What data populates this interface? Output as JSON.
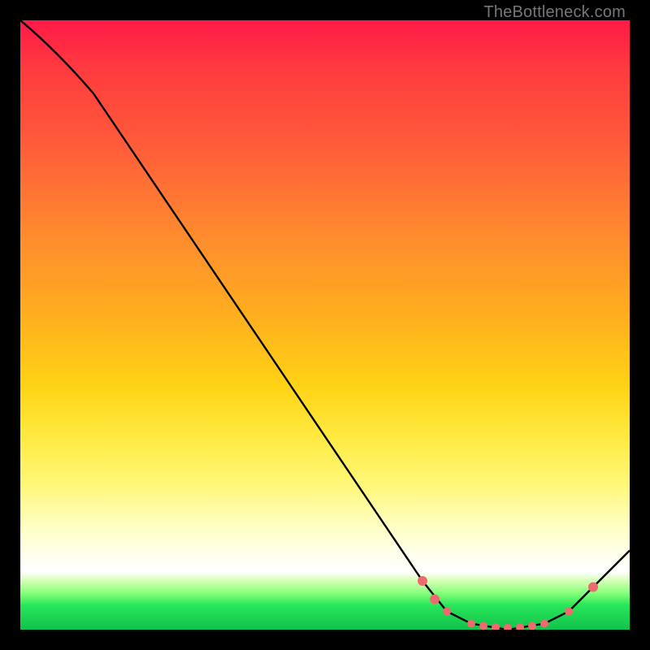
{
  "attribution": "TheBottleneck.com",
  "chart_data": {
    "type": "line",
    "title": "",
    "xlabel": "",
    "ylabel": "",
    "x_range": [
      0,
      100
    ],
    "y_range": [
      0,
      100
    ],
    "curve": {
      "name": "bottleneck-curve",
      "points": [
        {
          "x": 0,
          "y": 100
        },
        {
          "x": 6,
          "y": 95
        },
        {
          "x": 12,
          "y": 88
        },
        {
          "x": 66,
          "y": 8
        },
        {
          "x": 70,
          "y": 3
        },
        {
          "x": 74,
          "y": 1
        },
        {
          "x": 80,
          "y": 0
        },
        {
          "x": 86,
          "y": 1
        },
        {
          "x": 90,
          "y": 3
        },
        {
          "x": 100,
          "y": 13
        }
      ]
    },
    "markers": [
      {
        "x": 66,
        "y": 8,
        "r": 6
      },
      {
        "x": 68,
        "y": 5,
        "r": 6
      },
      {
        "x": 70,
        "y": 3,
        "r": 5
      },
      {
        "x": 74,
        "y": 1,
        "r": 5
      },
      {
        "x": 76,
        "y": 0.6,
        "r": 5
      },
      {
        "x": 78,
        "y": 0.4,
        "r": 5
      },
      {
        "x": 80,
        "y": 0.3,
        "r": 5
      },
      {
        "x": 82,
        "y": 0.4,
        "r": 5
      },
      {
        "x": 84,
        "y": 0.6,
        "r": 5
      },
      {
        "x": 86,
        "y": 1,
        "r": 5
      },
      {
        "x": 90,
        "y": 3,
        "r": 5
      },
      {
        "x": 94,
        "y": 7,
        "r": 6
      }
    ],
    "marker_color": "#ef6a6e",
    "curve_color": "#000000",
    "curve_width": 2.4
  }
}
